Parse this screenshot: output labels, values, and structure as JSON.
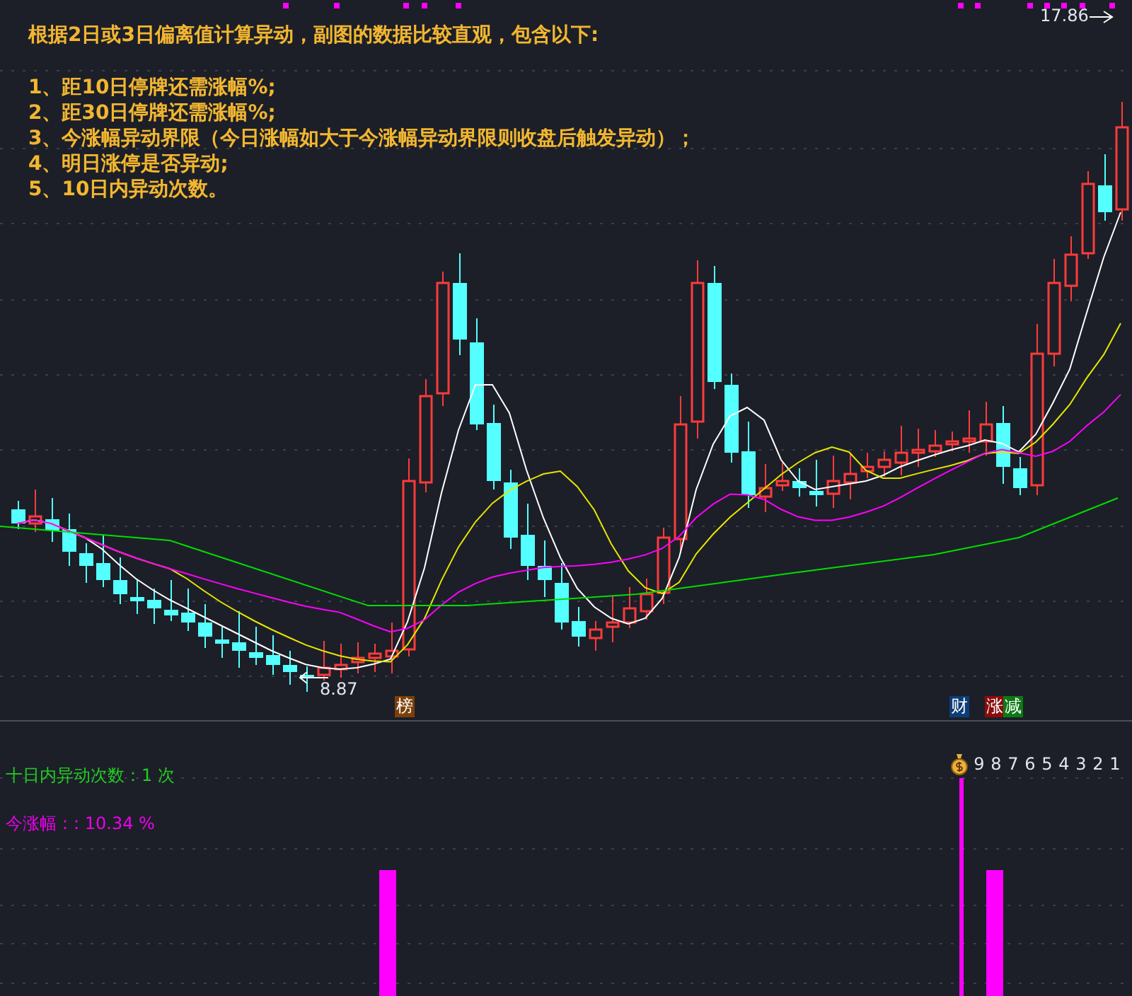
{
  "header": {
    "title": "根据2日或3日偏离值计算异动，副图的数据比较直观，包含以下:",
    "items": [
      "1、距10日停牌还需涨幅%;",
      "2、距30日停牌还需涨幅%;",
      "3、今涨幅异动界限（今日涨幅如大于今涨幅异动界限则收盘后触发异动）；",
      "4、明日涨停是否异动;",
      "5、10日内异动次数。"
    ]
  },
  "main_chart": {
    "high_label": "17.86",
    "low_label": "8.87",
    "tags": [
      {
        "text": "榜",
        "color": "#7a4008"
      },
      {
        "text": "财",
        "color": "#0c3d78"
      },
      {
        "text": "涨",
        "color": "#8a0c0c"
      },
      {
        "text": "减",
        "color": "#0c7a14"
      }
    ]
  },
  "sub_chart": {
    "count_label": "十日内异动次数：1 次",
    "rise_label": "今涨幅：: 10.34 %",
    "countdown": [
      "9",
      "8",
      "7",
      "6",
      "5",
      "4",
      "3",
      "2",
      "1"
    ]
  }
}
